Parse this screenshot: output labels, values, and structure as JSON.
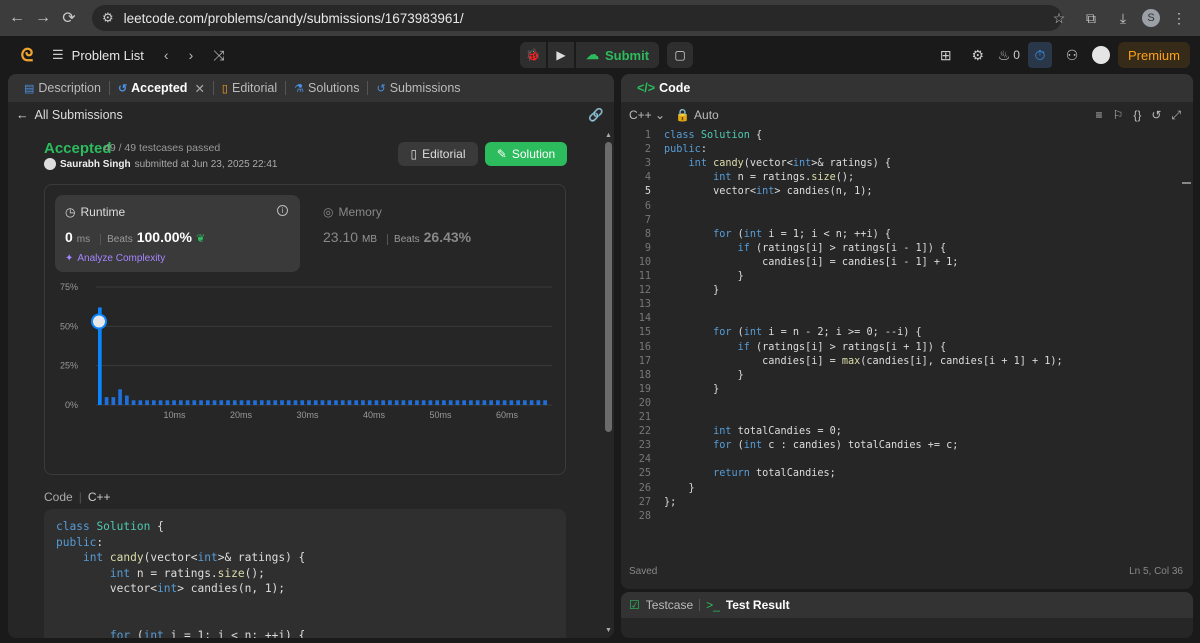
{
  "browser": {
    "url": "leetcode.com/problems/candy/submissions/1673983961/",
    "profile_initial": "S"
  },
  "nav": {
    "problem_list": "Problem List",
    "submit": "Submit",
    "streak_count": "0",
    "premium": "Premium"
  },
  "left_tabs": [
    {
      "label": "Description"
    },
    {
      "label": "Accepted"
    },
    {
      "label": "Editorial"
    },
    {
      "label": "Solutions"
    },
    {
      "label": "Submissions"
    }
  ],
  "submission": {
    "back_label": "All Submissions",
    "status": "Accepted",
    "testcases": "49 / 49 testcases passed",
    "user": "Saurabh Singh",
    "submitted_text": "submitted at Jun 23, 2025 22:41",
    "editorial_btn": "Editorial",
    "solution_btn": "Solution",
    "runtime": {
      "label": "Runtime",
      "value": "0",
      "unit": "ms",
      "beats_label": "Beats",
      "beats": "100.00%",
      "analyze": "Analyze Complexity"
    },
    "memory": {
      "label": "Memory",
      "value": "23.10",
      "unit": "MB",
      "beats_label": "Beats",
      "beats": "26.43%"
    },
    "code_label": "Code",
    "code_lang": "C++",
    "code_preview": "class Solution {\npublic:\n    int candy(vector<int>& ratings) {\n        int n = ratings.size();\n        vector<int> candies(n, 1);\n\n\n        for (int i = 1; i < n; ++i) {"
  },
  "chart_data": {
    "type": "bar",
    "ylabel": "",
    "ylim": [
      0,
      75
    ],
    "yticks": [
      "75%",
      "50%",
      "25%",
      "0%"
    ],
    "xticks": [
      "10ms",
      "20ms",
      "30ms",
      "40ms",
      "50ms",
      "60ms"
    ],
    "values": [
      62,
      5,
      5,
      10,
      6,
      3,
      3,
      3,
      3,
      3,
      3,
      3,
      3,
      3,
      3,
      3,
      3,
      3,
      3,
      3,
      3,
      3,
      3,
      3,
      3,
      3,
      3,
      3,
      3,
      3,
      3,
      3,
      3,
      3,
      3,
      3,
      3,
      3,
      3,
      3,
      3,
      3,
      3,
      3,
      3,
      3,
      3,
      3,
      3,
      3,
      3,
      3,
      3,
      3,
      3,
      3,
      3,
      3,
      3,
      3,
      3,
      3,
      3,
      3,
      3,
      3,
      3
    ],
    "highlight_index": 0,
    "colors": {
      "bar": "#0a84ff",
      "bar_dim": "#1e6fd9",
      "grid": "#3a3a3a"
    }
  },
  "editor": {
    "tab_label": "Code",
    "language": "C++",
    "mode": "Auto",
    "saved": "Saved",
    "position": "Ln 5, Col 36",
    "lines": [
      "class Solution {",
      "public:",
      "    int candy(vector<int>& ratings) {",
      "        int n = ratings.size();",
      "        vector<int> candies(n, 1);",
      "",
      "",
      "        for (int i = 1; i < n; ++i) {",
      "            if (ratings[i] > ratings[i - 1]) {",
      "                candies[i] = candies[i - 1] + 1;",
      "            }",
      "        }",
      "",
      "",
      "        for (int i = n - 2; i >= 0; --i) {",
      "            if (ratings[i] > ratings[i + 1]) {",
      "                candies[i] = max(candies[i], candies[i + 1] + 1);",
      "            }",
      "        }",
      "",
      "",
      "        int totalCandies = 0;",
      "        for (int c : candies) totalCandies += c;",
      "",
      "        return totalCandies;",
      "    }",
      "};",
      ""
    ]
  },
  "bottom_tabs": {
    "testcase": "Testcase",
    "test_result": "Test Result"
  }
}
